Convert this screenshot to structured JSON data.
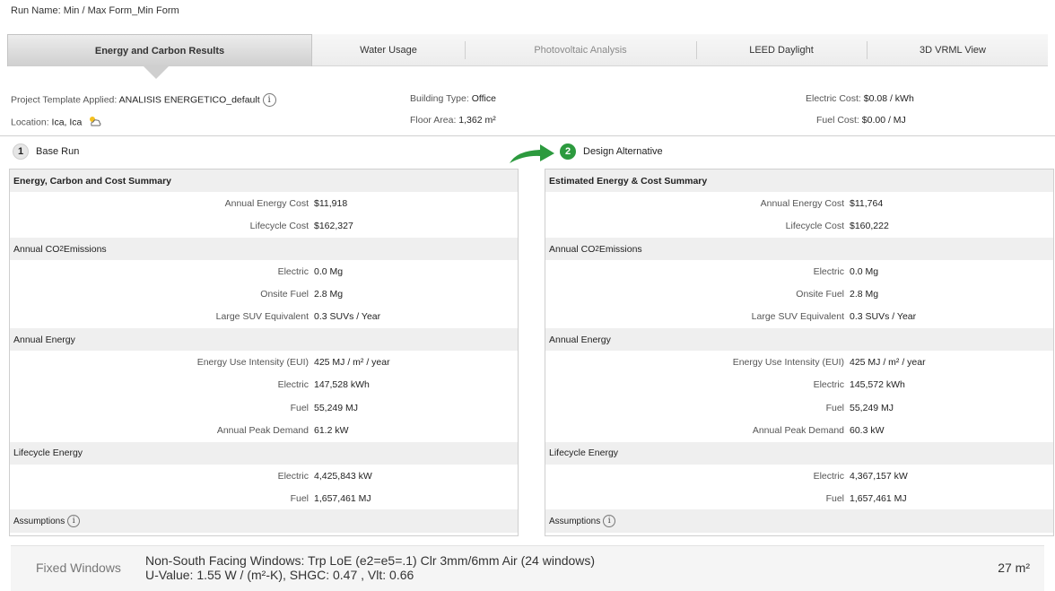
{
  "run_name": "Run Name: Min / Max Form_Min Form",
  "tabs": [
    {
      "label": "Energy and Carbon Results",
      "state": "active"
    },
    {
      "label": "Water Usage",
      "state": "normal"
    },
    {
      "label": "Photovoltaic Analysis",
      "state": "disabled"
    },
    {
      "label": "LEED Daylight",
      "state": "normal"
    },
    {
      "label": "3D VRML View",
      "state": "normal"
    }
  ],
  "info": {
    "template_label": "Project Template Applied:",
    "template_value": "ANALISIS ENERGETICO_default",
    "location_label": "Location:",
    "location_value": "Ica, Ica",
    "building_type_label": "Building Type:",
    "building_type_value": "Office",
    "floor_area_label": "Floor Area:",
    "floor_area_value": "1,362 m²",
    "electric_cost_label": "Electric Cost:",
    "electric_cost_value": "$0.08 / kWh",
    "fuel_cost_label": "Fuel Cost:",
    "fuel_cost_value": "$0.00 / MJ"
  },
  "base_run": {
    "number": "1",
    "title": "Base Run",
    "summary_title": "Energy, Carbon and Cost Summary",
    "rows": {
      "annual_energy_cost": {
        "label": "Annual Energy Cost",
        "value": "$11,918"
      },
      "lifecycle_cost": {
        "label": "Lifecycle Cost",
        "value": "$162,327"
      },
      "co2_electric": {
        "label": "Electric",
        "value": "0.0 Mg"
      },
      "co2_onsite_fuel": {
        "label": "Onsite Fuel",
        "value": "2.8 Mg"
      },
      "co2_suv": {
        "label": "Large SUV Equivalent",
        "value": "0.3 SUVs / Year"
      },
      "eui": {
        "label": "Energy Use Intensity (EUI)",
        "value": "425 MJ / m² / year"
      },
      "energy_electric": {
        "label": "Electric",
        "value": "147,528 kWh"
      },
      "energy_fuel": {
        "label": "Fuel",
        "value": "55,249 MJ"
      },
      "peak_demand": {
        "label": "Annual Peak Demand",
        "value": "61.2 kW"
      },
      "lifecycle_electric": {
        "label": "Electric",
        "value": "4,425,843 kW"
      },
      "lifecycle_fuel": {
        "label": "Fuel",
        "value": "1,657,461 MJ"
      }
    }
  },
  "design_alt": {
    "number": "2",
    "title": "Design Alternative",
    "summary_title": "Estimated Energy & Cost Summary",
    "rows": {
      "annual_energy_cost": {
        "label": "Annual Energy Cost",
        "value": "$11,764"
      },
      "lifecycle_cost": {
        "label": "Lifecycle Cost",
        "value": "$160,222"
      },
      "co2_electric": {
        "label": "Electric",
        "value": "0.0 Mg"
      },
      "co2_onsite_fuel": {
        "label": "Onsite Fuel",
        "value": "2.8 Mg"
      },
      "co2_suv": {
        "label": "Large SUV Equivalent",
        "value": "0.3 SUVs / Year"
      },
      "eui": {
        "label": "Energy Use Intensity (EUI)",
        "value": "425 MJ / m² / year"
      },
      "energy_electric": {
        "label": "Electric",
        "value": "145,572 kWh"
      },
      "energy_fuel": {
        "label": "Fuel",
        "value": "55,249 MJ"
      },
      "peak_demand": {
        "label": "Annual Peak Demand",
        "value": "60.3 kW"
      },
      "lifecycle_electric": {
        "label": "Electric",
        "value": "4,367,157 kW"
      },
      "lifecycle_fuel": {
        "label": "Fuel",
        "value": "1,657,461 MJ"
      }
    }
  },
  "sections": {
    "co2_prefix": "Annual CO",
    "co2_sub": "2",
    "co2_suffix": " Emissions",
    "annual_energy": "Annual Energy",
    "lifecycle_energy": "Lifecycle Energy",
    "assumptions": "Assumptions"
  },
  "windows": {
    "label": "Fixed Windows",
    "line1": "Non-South Facing Windows: Trp LoE (e2=e5=.1) Clr 3mm/6mm Air (24 windows)",
    "line2": "U-Value: 1.55 W / (m²-K), SHGC: 0.47 , Vlt: 0.66",
    "area": "27 m²"
  },
  "colors": {
    "accent_green": "#2c9a3e",
    "header_grey": "#efefef"
  },
  "icons": {
    "info": "info-icon",
    "weather": "cloud-sun-icon",
    "arrow": "curved-arrow-icon"
  }
}
